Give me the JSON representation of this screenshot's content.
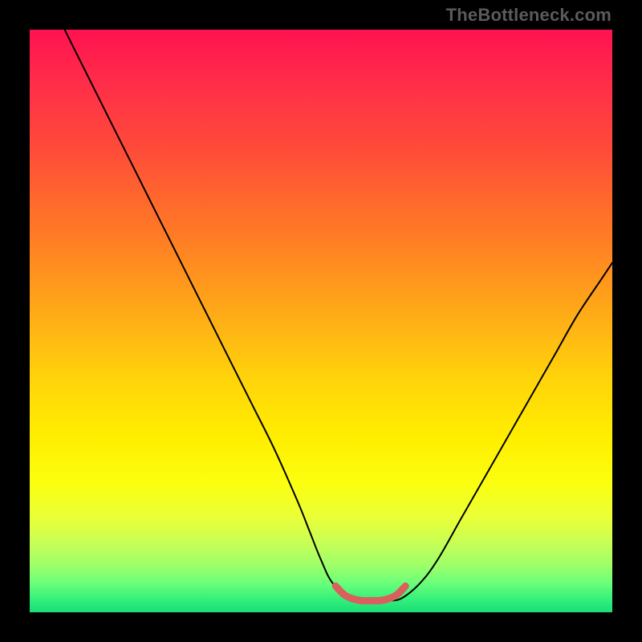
{
  "attribution": "TheBottleneck.com",
  "chart_data": {
    "type": "line",
    "title": "",
    "xlabel": "",
    "ylabel": "",
    "xlim": [
      0,
      100
    ],
    "ylim": [
      0,
      100
    ],
    "series": [
      {
        "name": "black-curve",
        "color": "#000000",
        "stroke_width": 2,
        "x": [
          6,
          10,
          14,
          18,
          22,
          26,
          30,
          34,
          38,
          42,
          46,
          48,
          50,
          52,
          55,
          58,
          60,
          62,
          64,
          67,
          70,
          74,
          78,
          82,
          86,
          90,
          94,
          98,
          100
        ],
        "y": [
          100,
          92,
          84,
          76,
          68,
          60,
          52,
          44,
          36,
          28,
          19,
          14,
          9,
          5,
          2.5,
          2.0,
          2.0,
          2.0,
          2.5,
          5,
          9,
          16,
          23,
          30,
          37,
          44,
          51,
          57,
          60
        ]
      },
      {
        "name": "red-bottom-segment",
        "color": "#d9605c",
        "stroke_width": 9,
        "x": [
          52.5,
          54,
          55.5,
          57,
          58.5,
          60,
          61.5,
          63,
          64.5
        ],
        "y": [
          4.5,
          3.0,
          2.3,
          2.0,
          2.0,
          2.0,
          2.3,
          3.0,
          4.5
        ]
      }
    ],
    "annotations": []
  }
}
